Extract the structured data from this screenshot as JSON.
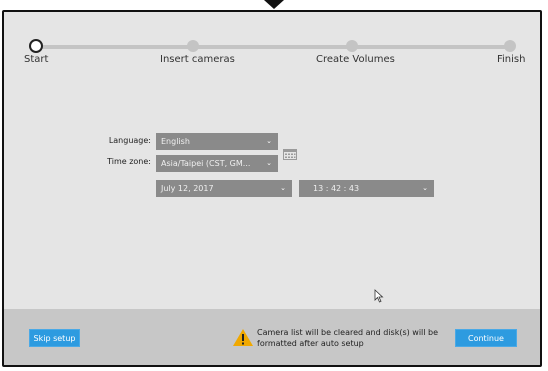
{
  "wizard": {
    "steps": [
      {
        "label": "Start"
      },
      {
        "label": "Insert cameras"
      },
      {
        "label": "Create Volumes"
      },
      {
        "label": "Finish"
      }
    ]
  },
  "form": {
    "language_label": "Language:",
    "language_value": "English",
    "timezone_label": "Time zone:",
    "timezone_value": "Asia/Taipei (CST, GM...",
    "date_value": "July 12, 2017",
    "time_value": "13  :  42  :  43"
  },
  "footer": {
    "skip_label": "Skip setup",
    "warning_text": "Camera list will be cleared and disk(s) will be formatted after auto setup",
    "continue_label": "Continue"
  },
  "colors": {
    "accent": "#2d9be0",
    "warning": "#f0a800"
  },
  "icons": [
    "calendar-icon",
    "warning-icon",
    "chevron-down-icon",
    "mouse-cursor-icon"
  ]
}
